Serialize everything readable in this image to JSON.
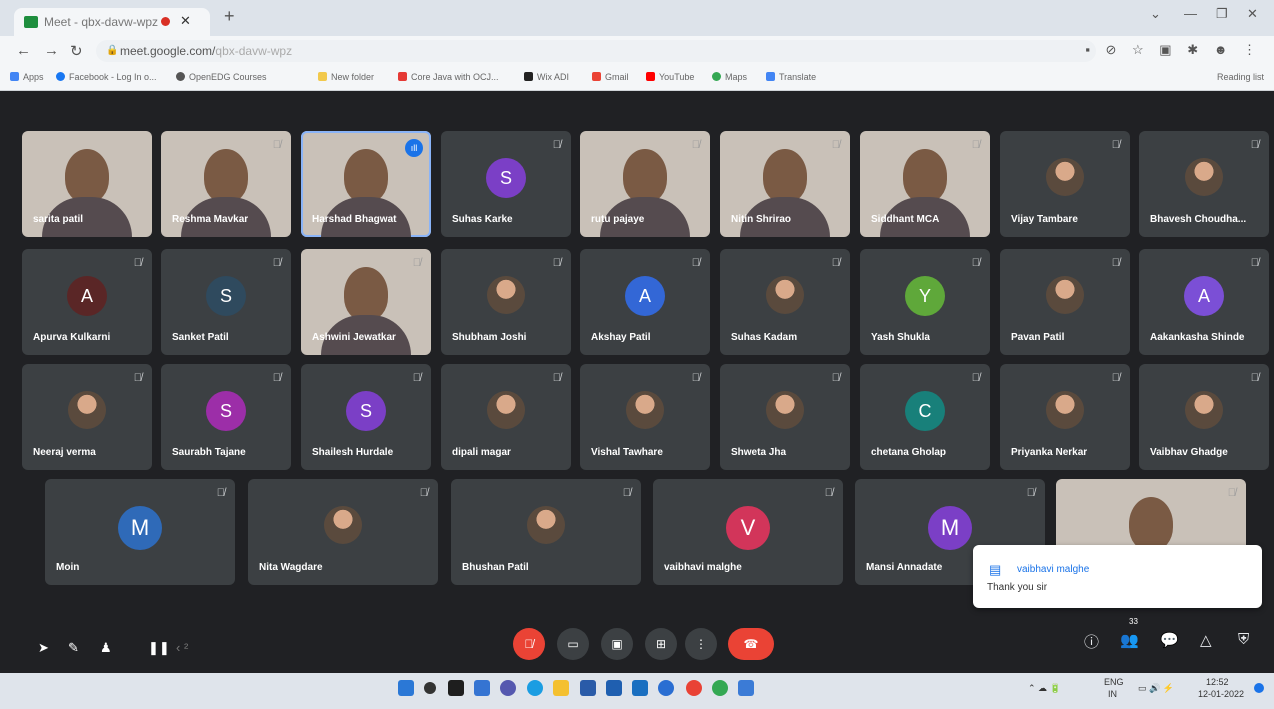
{
  "browser": {
    "tab_title": "Meet - qbx-davw-wpz",
    "tab_close": "✕",
    "new_tab": "+",
    "window_controls": [
      "⌄",
      "—",
      "❐",
      "✕"
    ],
    "nav": [
      "←",
      "→",
      "↻"
    ],
    "url_host": "meet.google.com/",
    "url_path": "qbx-davw-wpz",
    "bookmarks": [
      "Apps",
      "Facebook - Log In o...",
      "OpenEDG Courses",
      "New folder",
      "Core Java with OCJ...",
      "Wix ADI",
      "Gmail",
      "YouTube",
      "Maps",
      "Translate"
    ],
    "reading_list": "Reading list",
    "extras": "▪ ⊘ ☆ ▣ ✱ ☻ ⋮"
  },
  "participants": [
    {
      "name": "sarita patil",
      "type": "camera",
      "muted": false
    },
    {
      "name": "Reshma Mavkar",
      "type": "camera",
      "muted": true
    },
    {
      "name": "Harshad Bhagwat",
      "type": "camera",
      "speaking": true
    },
    {
      "name": "Suhas Karke",
      "type": "avatar",
      "initial": "S",
      "color": "#7b3fc6"
    },
    {
      "name": "rutu pajaye",
      "type": "camera",
      "muted": true
    },
    {
      "name": "Nitin Shrirao",
      "type": "camera",
      "muted": true
    },
    {
      "name": "Siddhant MCA",
      "type": "camera",
      "muted": true
    },
    {
      "name": "Vijay Tambare",
      "type": "photo"
    },
    {
      "name": "Bhavesh Choudha...",
      "type": "photo"
    },
    {
      "name": "Apurva Kulkarni",
      "type": "avatar",
      "initial": "A",
      "color": "#5a2626"
    },
    {
      "name": "Sanket Patil",
      "type": "avatar",
      "initial": "S",
      "color": "#2f4a5e"
    },
    {
      "name": "Ashwini Jewatkar",
      "type": "camera",
      "muted": true
    },
    {
      "name": "Shubham Joshi",
      "type": "photo"
    },
    {
      "name": "Akshay Patil",
      "type": "avatar",
      "initial": "A",
      "color": "#3367d6"
    },
    {
      "name": "Suhas Kadam",
      "type": "photo"
    },
    {
      "name": "Yash Shukla",
      "type": "avatar",
      "initial": "Y",
      "color": "#5fa83a"
    },
    {
      "name": "Pavan Patil",
      "type": "photo"
    },
    {
      "name": "Aakankasha Shinde",
      "type": "avatar",
      "initial": "A",
      "color": "#7b4fd6"
    },
    {
      "name": "Neeraj verma",
      "type": "photo"
    },
    {
      "name": "Saurabh Tajane",
      "type": "avatar",
      "initial": "S",
      "color": "#9c2ea8"
    },
    {
      "name": "Shailesh Hurdale",
      "type": "avatar",
      "initial": "S",
      "color": "#7b3fc6"
    },
    {
      "name": "dipali magar",
      "type": "photo"
    },
    {
      "name": "Vishal Tawhare",
      "type": "photo"
    },
    {
      "name": "Shweta Jha",
      "type": "photo"
    },
    {
      "name": "chetana Gholap",
      "type": "avatar",
      "initial": "C",
      "color": "#18807a"
    },
    {
      "name": "Priyanka Nerkar",
      "type": "photo"
    },
    {
      "name": "Vaibhav Ghadge",
      "type": "photo"
    },
    {
      "name": "Moin",
      "type": "avatar",
      "initial": "M",
      "color": "#2f6ab8"
    },
    {
      "name": "Nita Wagdare",
      "type": "photo"
    },
    {
      "name": "Bhushan Patil",
      "type": "photo"
    },
    {
      "name": "vaibhavi malghe",
      "type": "avatar",
      "initial": "V",
      "color": "#d2355a"
    },
    {
      "name": "Mansi Annadate",
      "type": "avatar",
      "initial": "M",
      "color": "#7b3fc6"
    },
    {
      "name": "",
      "type": "camera",
      "muted": true
    }
  ],
  "icons": {
    "mute": "🎙̸",
    "speaking": "ıll"
  },
  "chat_popup": {
    "sender": "vaibhavi malghe",
    "message": "Thank you sir",
    "icon": "▤"
  },
  "controls": {
    "left_tools": [
      "➤",
      "✎",
      "♟",
      "❚❚",
      "‹ ²"
    ],
    "mic": "🎙̸",
    "camera": "▭",
    "captions": "▣",
    "present": "⊞",
    "more": "⋮",
    "leave": "☎",
    "participants_badge": "33",
    "right": [
      "ⓘ",
      "👥",
      "💬",
      "△",
      "⛨"
    ]
  },
  "taskbar": {
    "lang": "ENG",
    "region": "IN",
    "time": "12:52",
    "date": "12-01-2022"
  }
}
